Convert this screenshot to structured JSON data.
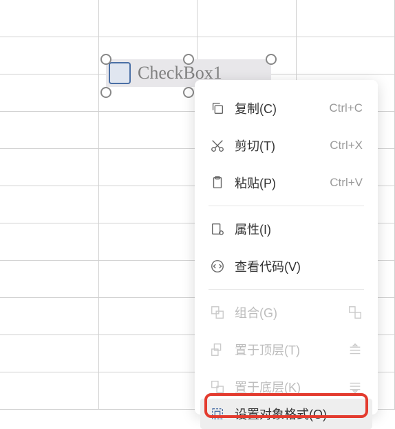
{
  "checkbox": {
    "label": "CheckBox1"
  },
  "menu": {
    "items": [
      {
        "label": "复制(C)",
        "shortcut": "Ctrl+C",
        "icon": "copy"
      },
      {
        "label": "剪切(T)",
        "shortcut": "Ctrl+X",
        "icon": "cut"
      },
      {
        "label": "粘贴(P)",
        "shortcut": "Ctrl+V",
        "icon": "paste"
      },
      {
        "label": "属性(I)",
        "icon": "properties"
      },
      {
        "label": "查看代码(V)",
        "icon": "code"
      },
      {
        "label": "组合(G)",
        "icon": "group",
        "disabled": true,
        "side": "ungroup"
      },
      {
        "label": "置于顶层(T)",
        "icon": "front",
        "disabled": true,
        "side": "layers-up"
      },
      {
        "label": "置于底层(K)",
        "icon": "back",
        "disabled": true,
        "side": "layers-down"
      },
      {
        "label": "设置对象格式(O)",
        "icon": "format"
      }
    ]
  }
}
